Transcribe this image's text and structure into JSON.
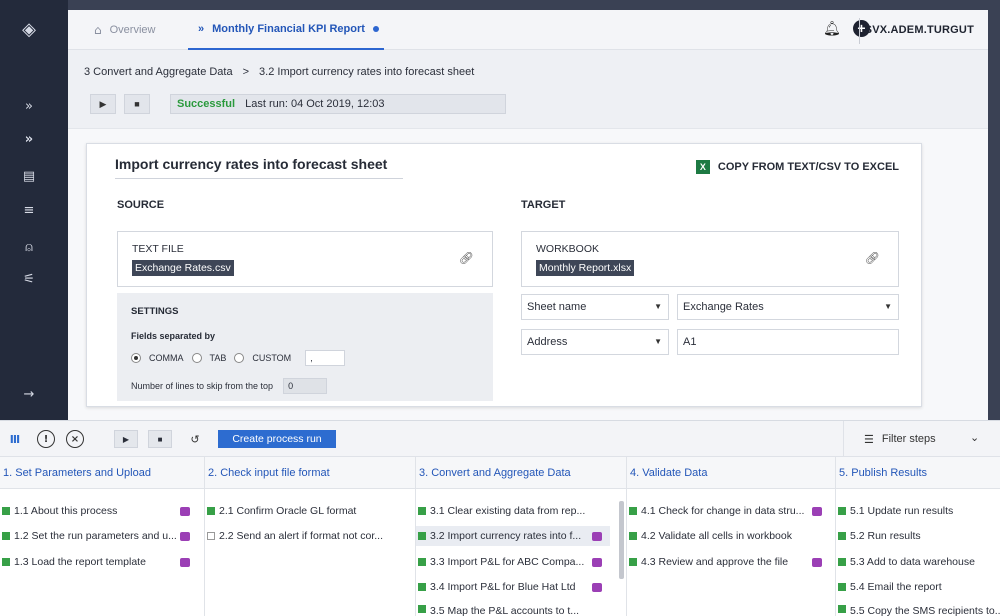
{
  "tabs": {
    "overview": "Overview",
    "active": "Monthly Financial KPI Report"
  },
  "user": "SVX.ADEM.TURGUT",
  "breadcrumb": {
    "parent": "3 Convert and Aggregate Data",
    "sep": ">",
    "current": "3.2 Import currency rates into forecast sheet"
  },
  "run": {
    "status": "Successful",
    "last_run": "Last run: 04 Oct 2019, 12:03"
  },
  "card": {
    "title": "Import currency rates into forecast sheet",
    "action": "COPY FROM TEXT/CSV TO EXCEL",
    "source": {
      "heading": "SOURCE",
      "type_label": "TEXT FILE",
      "file": "Exchange Rates.csv",
      "settings": {
        "heading": "SETTINGS",
        "fields_label": "Fields separated by",
        "options": [
          "COMMA",
          "TAB",
          "CUSTOM"
        ],
        "selected": "COMMA",
        "custom_value": ",",
        "skip_label": "Number of lines to skip from the top",
        "skip_value": "0"
      }
    },
    "target": {
      "heading": "TARGET",
      "type_label": "WORKBOOK",
      "file": "Monthly Report.xlsx",
      "sheet_label": "Sheet name",
      "sheet_value": "Exchange Rates",
      "address_label": "Address",
      "address_value": "A1"
    }
  },
  "bottom": {
    "create_label": "Create process run",
    "filter_label": "Filter steps",
    "columns": [
      {
        "title": "1. Set Parameters and Upload",
        "steps": [
          {
            "label": "1.1 About this process",
            "done": true,
            "msg": true
          },
          {
            "label": "1.2 Set the run parameters and u...",
            "done": true,
            "msg": true
          },
          {
            "label": "1.3 Load the report template",
            "done": true,
            "msg": true
          }
        ]
      },
      {
        "title": "2. Check input file format",
        "steps": [
          {
            "label": "2.1 Confirm Oracle GL format",
            "done": true,
            "msg": false
          },
          {
            "label": "2.2 Send an alert if format not cor...",
            "done": false,
            "msg": false
          }
        ]
      },
      {
        "title": "3. Convert and Aggregate Data",
        "steps": [
          {
            "label": "3.1 Clear existing data from rep...",
            "done": true,
            "msg": false
          },
          {
            "label": "3.2 Import currency rates into f...",
            "done": true,
            "msg": true
          },
          {
            "label": "3.3 Import P&L for ABC Compa...",
            "done": true,
            "msg": true
          },
          {
            "label": "3.4 Import P&L for Blue Hat Ltd",
            "done": true,
            "msg": true
          },
          {
            "label": "3.5 Map the P&L accounts to t...",
            "done": true,
            "msg": false
          }
        ]
      },
      {
        "title": "4. Validate Data",
        "steps": [
          {
            "label": "4.1 Check for change in data stru...",
            "done": true,
            "msg": true
          },
          {
            "label": "4.2 Validate all cells in workbook",
            "done": true,
            "msg": false
          },
          {
            "label": "4.3 Review and approve the file",
            "done": true,
            "msg": true
          }
        ]
      },
      {
        "title": "5. Publish Results",
        "steps": [
          {
            "label": "5.1 Update run results",
            "done": true,
            "msg": false
          },
          {
            "label": "5.2 Run results",
            "done": true,
            "msg": false
          },
          {
            "label": "5.3 Add to data warehouse",
            "done": true,
            "msg": false
          },
          {
            "label": "5.4 Email the report",
            "done": true,
            "msg": false
          },
          {
            "label": "5.5 Copy the SMS recipients to...",
            "done": true,
            "msg": false
          }
        ]
      }
    ]
  }
}
